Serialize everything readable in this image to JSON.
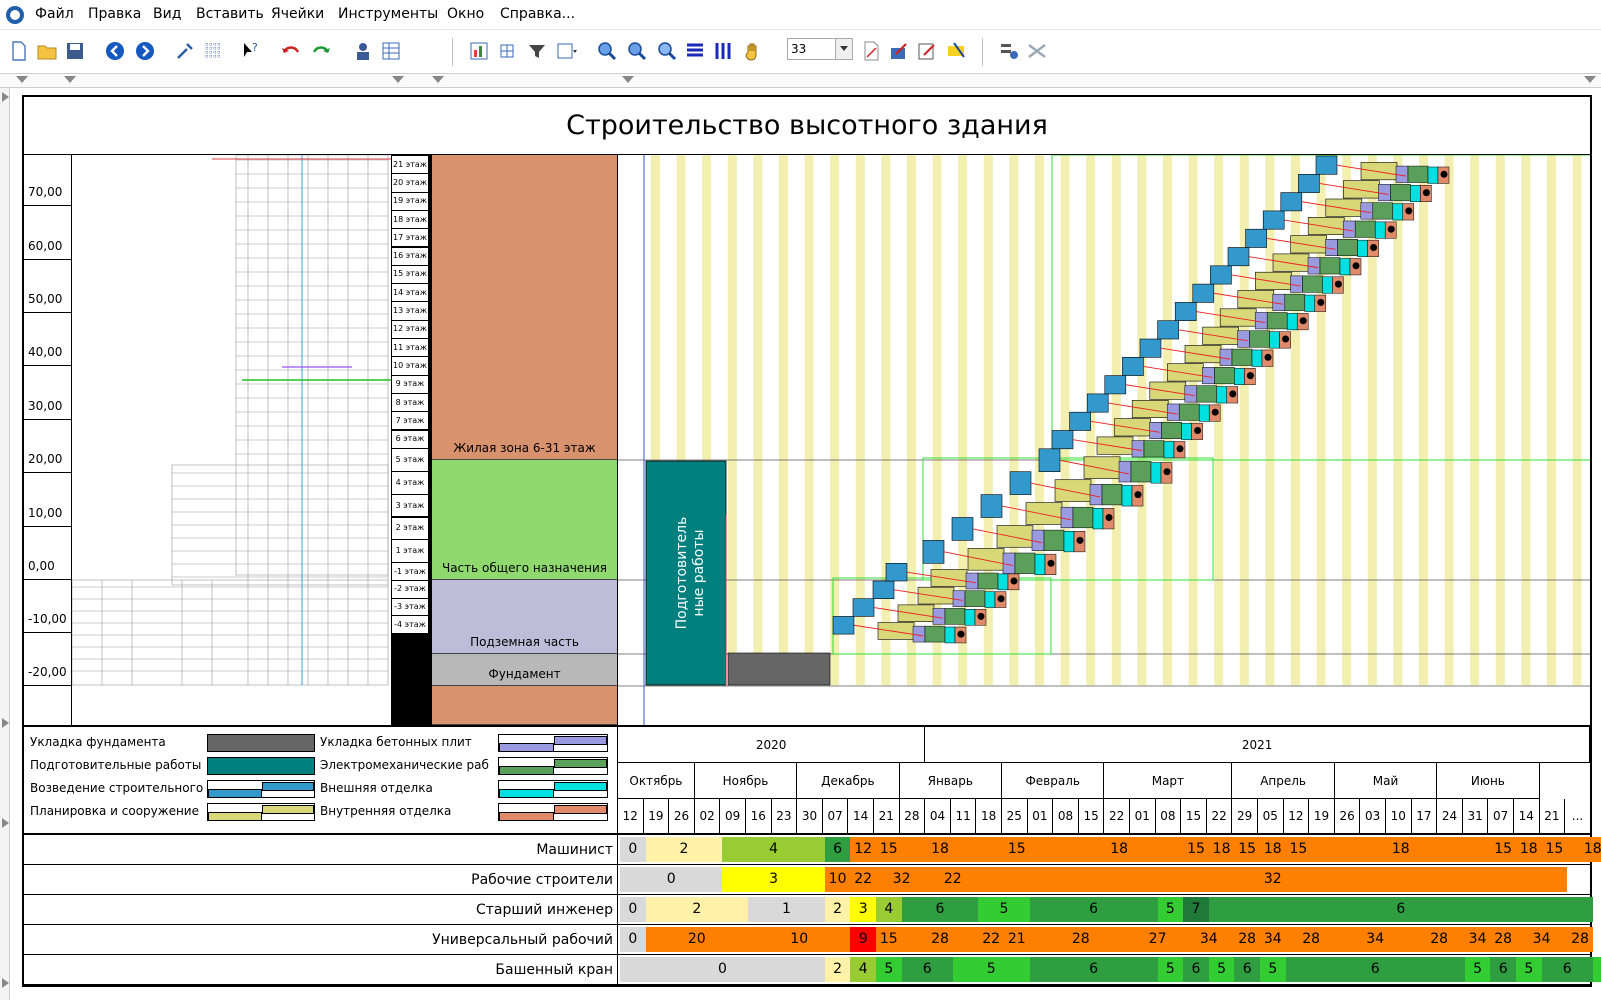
{
  "menu": {
    "items": [
      "Файл",
      "Правка",
      "Вид",
      "Вставить",
      "Ячейки",
      "Инструменты",
      "Окно",
      "Справка..."
    ]
  },
  "toolbar": {
    "zoom_value": "33"
  },
  "chart": {
    "title": "Строительство высотного здания"
  },
  "scale": {
    "labels": [
      "70,00",
      "60,00",
      "50,00",
      "40,00",
      "30,00",
      "20,00",
      "10,00",
      "0,00",
      "-10,00",
      "-20,00"
    ]
  },
  "floors": [
    "21 этаж",
    "20 этаж",
    "19 этаж",
    "18 этаж",
    "17 этаж",
    "16 этаж",
    "15 этаж",
    "14 этаж",
    "13 этаж",
    "12 этаж",
    "11 этаж",
    "10 этаж",
    "9 этаж",
    "8 этаж",
    "7 этаж",
    "6 этаж",
    "5 этаж",
    "4 этаж",
    "3 этаж",
    "2 этаж",
    "1 этаж",
    "-1 этаж",
    "-2 этаж",
    "-3 этаж",
    "-4 этаж"
  ],
  "zones": [
    {
      "label": "Жилая зона 6-31 этаж",
      "color": "#d9926e"
    },
    {
      "label": "Часть общего назначения",
      "color": "#8fd96e"
    },
    {
      "label": "Подземная часть",
      "color": "#bdbdd9"
    },
    {
      "label": "Фундамент",
      "color": "#b8b8b8"
    }
  ],
  "prep_label": "Подготовительные работы",
  "legend": {
    "left": [
      "Укладка фундамента",
      "Подготовительные работы",
      "Возведение строительного",
      "Планировка и сооружение"
    ],
    "right": [
      "Укладка бетонных плит",
      "Электромеханические раб",
      "Внешняя отделка",
      "Внутренняя отделка"
    ]
  },
  "calendar": {
    "years": [
      "2020",
      "2021"
    ],
    "months": [
      "Октябрь",
      "Ноябрь",
      "Декабрь",
      "Январь",
      "Февраль",
      "Март",
      "Апрель",
      "Май",
      "Июнь"
    ],
    "weeks": [
      "12",
      "19",
      "26",
      "02",
      "09",
      "16",
      "23",
      "30",
      "07",
      "14",
      "21",
      "28",
      "04",
      "11",
      "18",
      "25",
      "01",
      "08",
      "15",
      "22",
      "01",
      "08",
      "15",
      "22",
      "29",
      "05",
      "12",
      "19",
      "26",
      "03",
      "10",
      "17",
      "24",
      "31",
      "07",
      "14",
      "21",
      "..."
    ]
  },
  "colors": {
    "orange": "#ff8000",
    "cream": "#fff2a8",
    "lime": "#99cc33",
    "green": "#2e9e40",
    "bright_green": "#33cc33",
    "dark_green": "#1f7a3a",
    "yellow": "#ffff00",
    "red": "#ff0000",
    "gray": "#d9d9d9",
    "teal": "#007f7f",
    "blue": "#3399cc"
  },
  "resources": [
    {
      "name": "Машинист",
      "cells": [
        {
          "v": "0",
          "span": 1,
          "c": "gray"
        },
        {
          "v": "2",
          "span": 3,
          "c": "cream"
        },
        {
          "v": "4",
          "span": 4,
          "c": "lime"
        },
        {
          "v": "6",
          "span": 1,
          "c": "green"
        },
        {
          "v": "12",
          "span": 1,
          "c": "orange"
        },
        {
          "v": "15",
          "span": 1,
          "c": "orange"
        },
        {
          "v": "18",
          "span": 3,
          "c": "orange"
        },
        {
          "v": "15",
          "span": 3,
          "c": "orange"
        },
        {
          "v": "18",
          "span": 5,
          "c": "orange"
        },
        {
          "v": "15",
          "span": 1,
          "c": "orange"
        },
        {
          "v": "18",
          "span": 1,
          "c": "orange"
        },
        {
          "v": "15",
          "span": 1,
          "c": "orange"
        },
        {
          "v": "18",
          "span": 1,
          "c": "orange"
        },
        {
          "v": "15",
          "span": 1,
          "c": "orange"
        },
        {
          "v": "18",
          "span": 7,
          "c": "orange"
        },
        {
          "v": "15",
          "span": 1,
          "c": "orange"
        },
        {
          "v": "18",
          "span": 1,
          "c": "orange"
        },
        {
          "v": "15",
          "span": 1,
          "c": "orange"
        },
        {
          "v": "18",
          "span": 2,
          "c": "orange"
        },
        {
          "v": "",
          "span": 1,
          "c": "orange"
        }
      ]
    },
    {
      "name": "Рабочие строители",
      "cells": [
        {
          "v": "0",
          "span": 4,
          "c": "gray"
        },
        {
          "v": "3",
          "span": 4,
          "c": "yellow"
        },
        {
          "v": "10",
          "span": 1,
          "c": "orange"
        },
        {
          "v": "22",
          "span": 1,
          "c": "orange"
        },
        {
          "v": "32",
          "span": 2,
          "c": "orange"
        },
        {
          "v": "22",
          "span": 2,
          "c": "orange"
        },
        {
          "v": "32",
          "span": 23,
          "c": "orange"
        }
      ]
    },
    {
      "name": "Старший инженер",
      "cells": [
        {
          "v": "0",
          "span": 1,
          "c": "gray"
        },
        {
          "v": "2",
          "span": 4,
          "c": "cream"
        },
        {
          "v": "1",
          "span": 3,
          "c": "gray"
        },
        {
          "v": "2",
          "span": 1,
          "c": "cream"
        },
        {
          "v": "3",
          "span": 1,
          "c": "yellow"
        },
        {
          "v": "4",
          "span": 1,
          "c": "lime"
        },
        {
          "v": "6",
          "span": 3,
          "c": "green"
        },
        {
          "v": "5",
          "span": 2,
          "c": "bright_green"
        },
        {
          "v": "6",
          "span": 5,
          "c": "green"
        },
        {
          "v": "5",
          "span": 1,
          "c": "bright_green"
        },
        {
          "v": "7",
          "span": 1,
          "c": "dark_green"
        },
        {
          "v": "6",
          "span": 15,
          "c": "green"
        }
      ]
    },
    {
      "name": "Универсальный рабочий",
      "cells": [
        {
          "v": "0",
          "span": 1,
          "c": "gray"
        },
        {
          "v": "20",
          "span": 4,
          "c": "orange"
        },
        {
          "v": "10",
          "span": 4,
          "c": "orange"
        },
        {
          "v": "9",
          "span": 1,
          "c": "red"
        },
        {
          "v": "15",
          "span": 1,
          "c": "orange"
        },
        {
          "v": "28",
          "span": 3,
          "c": "orange"
        },
        {
          "v": "22",
          "span": 1,
          "c": "orange"
        },
        {
          "v": "21",
          "span": 1,
          "c": "orange"
        },
        {
          "v": "28",
          "span": 4,
          "c": "orange"
        },
        {
          "v": "27",
          "span": 2,
          "c": "orange"
        },
        {
          "v": "34",
          "span": 2,
          "c": "orange"
        },
        {
          "v": "28",
          "span": 1,
          "c": "orange"
        },
        {
          "v": "34",
          "span": 1,
          "c": "orange"
        },
        {
          "v": "28",
          "span": 2,
          "c": "orange"
        },
        {
          "v": "34",
          "span": 3,
          "c": "orange"
        },
        {
          "v": "28",
          "span": 2,
          "c": "orange"
        },
        {
          "v": "34",
          "span": 1,
          "c": "orange"
        },
        {
          "v": "28",
          "span": 1,
          "c": "orange"
        },
        {
          "v": "34",
          "span": 2,
          "c": "orange"
        },
        {
          "v": "28",
          "span": 1,
          "c": "orange"
        }
      ]
    },
    {
      "name": "Башенный кран",
      "cells": [
        {
          "v": "0",
          "span": 8,
          "c": "gray"
        },
        {
          "v": "2",
          "span": 1,
          "c": "cream"
        },
        {
          "v": "4",
          "span": 1,
          "c": "lime"
        },
        {
          "v": "5",
          "span": 1,
          "c": "bright_green"
        },
        {
          "v": "6",
          "span": 2,
          "c": "green"
        },
        {
          "v": "5",
          "span": 3,
          "c": "bright_green"
        },
        {
          "v": "6",
          "span": 5,
          "c": "green"
        },
        {
          "v": "5",
          "span": 1,
          "c": "bright_green"
        },
        {
          "v": "6",
          "span": 1,
          "c": "green"
        },
        {
          "v": "5",
          "span": 1,
          "c": "bright_green"
        },
        {
          "v": "6",
          "span": 1,
          "c": "green"
        },
        {
          "v": "5",
          "span": 1,
          "c": "bright_green"
        },
        {
          "v": "6",
          "span": 7,
          "c": "green"
        },
        {
          "v": "5",
          "span": 1,
          "c": "bright_green"
        },
        {
          "v": "6",
          "span": 1,
          "c": "green"
        },
        {
          "v": "5",
          "span": 1,
          "c": "bright_green"
        },
        {
          "v": "6",
          "span": 2,
          "c": "green"
        },
        {
          "v": "",
          "span": 1,
          "c": "bright_green"
        }
      ]
    }
  ]
}
